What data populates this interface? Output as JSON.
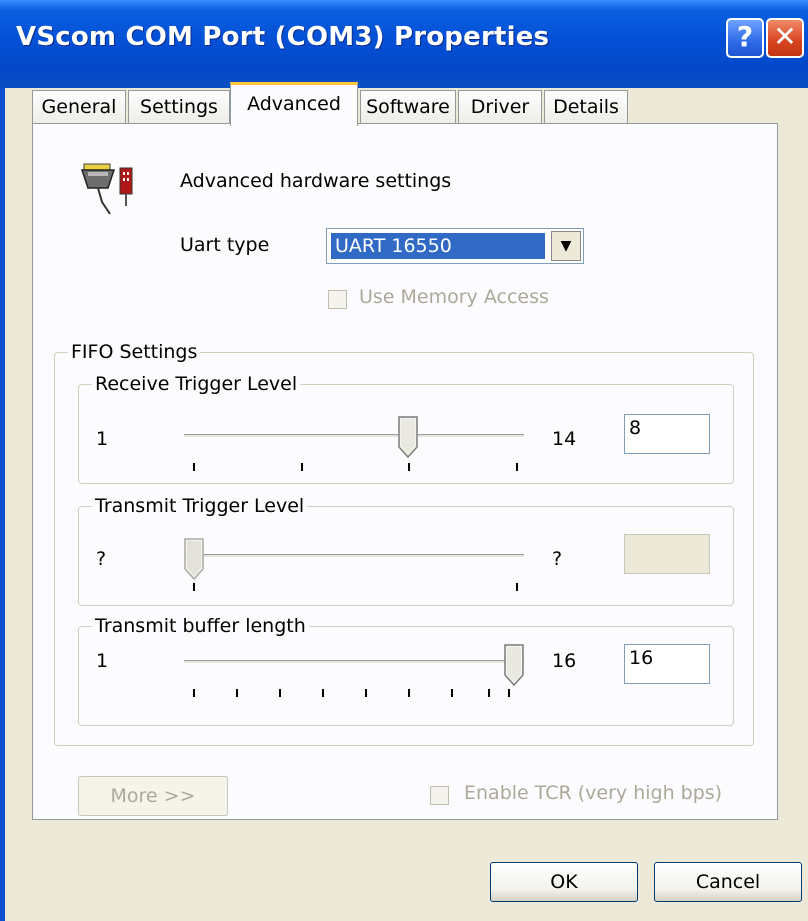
{
  "window": {
    "title": "VScom COM Port (COM3) Properties",
    "help_glyph": "?",
    "close_glyph": "✕"
  },
  "tabs": [
    {
      "label": "General"
    },
    {
      "label": "Settings"
    },
    {
      "label": "Advanced",
      "active": true
    },
    {
      "label": "Software"
    },
    {
      "label": "Driver"
    },
    {
      "label": "Details"
    }
  ],
  "advanced": {
    "heading": "Advanced hardware settings",
    "uart_label": "Uart type",
    "uart_value": "UART 16550",
    "use_memory_access": {
      "label": "Use Memory Access",
      "checked": false,
      "enabled": false
    }
  },
  "fifo": {
    "title": "FIFO Settings",
    "receive": {
      "title": "Receive Trigger Level",
      "min": "1",
      "max": "14",
      "value": "8"
    },
    "transmit": {
      "title": "Transmit Trigger Level",
      "min": "?",
      "max": "?",
      "value": ""
    },
    "buffer": {
      "title": "Transmit buffer length",
      "min": "1",
      "max": "16",
      "value": "16"
    }
  },
  "footer": {
    "more_label": "More >>",
    "tcr": {
      "label": "Enable TCR (very high bps)",
      "checked": false,
      "enabled": false
    }
  },
  "buttons": {
    "ok": "OK",
    "cancel": "Cancel"
  },
  "icons": [
    "serial-port-icon",
    "help-icon",
    "close-icon",
    "dropdown-arrow-icon",
    "slider-thumb-icon"
  ],
  "colors": {
    "titlebar": "#0450D6",
    "selection": "#316AC5",
    "active_tab_accent": "#FFC83C",
    "dialog_bg": "#ECE9D8"
  }
}
